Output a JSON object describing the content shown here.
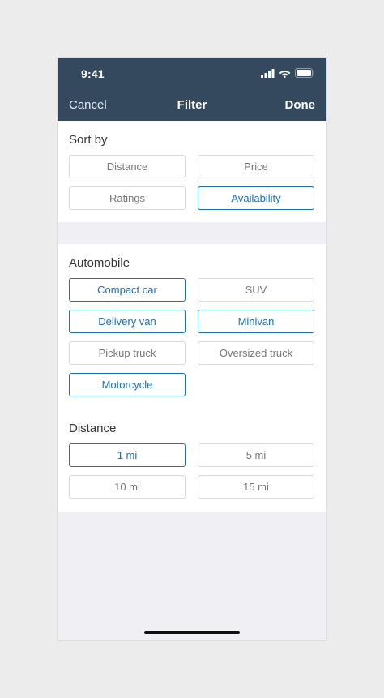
{
  "status_bar": {
    "time": "9:41",
    "icons": [
      "cellular-signal-icon",
      "wifi-icon",
      "battery-icon"
    ]
  },
  "nav": {
    "cancel_label": "Cancel",
    "title": "Filter",
    "done_label": "Done"
  },
  "sort_by": {
    "heading": "Sort by",
    "options": [
      {
        "label": "Distance",
        "selected": false
      },
      {
        "label": "Price",
        "selected": false
      },
      {
        "label": "Ratings",
        "selected": false
      },
      {
        "label": "Availability",
        "selected": true
      }
    ]
  },
  "automobile": {
    "heading": "Automobile",
    "options": [
      {
        "label": "Compact car",
        "selected": true
      },
      {
        "label": "SUV",
        "selected": false
      },
      {
        "label": "Delivery van",
        "selected": true
      },
      {
        "label": "Minivan",
        "selected": true
      },
      {
        "label": "Pickup truck",
        "selected": false
      },
      {
        "label": "Oversized truck",
        "selected": false
      },
      {
        "label": "Motorcycle",
        "selected": true
      }
    ]
  },
  "distance": {
    "heading": "Distance",
    "options": [
      {
        "label": "1 mi",
        "selected": true
      },
      {
        "label": "5 mi",
        "selected": false
      },
      {
        "label": "10 mi",
        "selected": false
      },
      {
        "label": "15 mi",
        "selected": false
      }
    ]
  },
  "colors": {
    "nav_background": "#34495e",
    "accent": "#1a6fb5",
    "chip_border": "#d9d9d9",
    "chip_text": "#777777",
    "page_background": "#efeff4"
  }
}
